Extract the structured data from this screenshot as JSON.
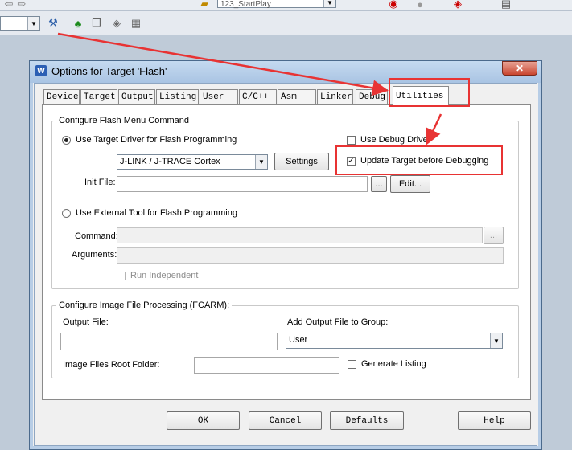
{
  "toolbar": {
    "target_combo_value": "",
    "project_combo_value": "123_StartPlay"
  },
  "dialog": {
    "title": "Options for Target 'Flash'",
    "close_glyph": "✕",
    "tabs": [
      "Device",
      "Target",
      "Output",
      "Listing",
      "User",
      "C/C++",
      "Asm",
      "Linker",
      "Debug",
      "Utilities"
    ],
    "active_tab": "Utilities"
  },
  "flash_group": {
    "title": "Configure Flash Menu Command",
    "use_target_driver_label": "Use Target Driver for Flash Programming",
    "use_debug_driver_label": "Use Debug Driver",
    "driver_value": "J-LINK / J-TRACE Cortex",
    "settings_label": "Settings",
    "update_target_label": "Update Target before Debugging",
    "init_file_label": "Init File:",
    "init_file_value": "",
    "browse_label": "...",
    "edit_label": "Edit...",
    "use_external_tool_label": "Use External Tool for Flash Programming",
    "command_label": "Command:",
    "command_value": "",
    "arguments_label": "Arguments:",
    "arguments_value": "",
    "run_independent_label": "Run Independent"
  },
  "image_group": {
    "title": "Configure Image File Processing (FCARM):",
    "output_file_label": "Output File:",
    "output_file_value": "",
    "add_output_label": "Add Output File  to Group:",
    "group_value": "User",
    "root_folder_label": "Image Files Root Folder:",
    "root_folder_value": "",
    "generate_listing_label": "Generate Listing"
  },
  "buttons": {
    "ok": "OK",
    "cancel": "Cancel",
    "defaults": "Defaults",
    "help": "Help"
  },
  "colors": {
    "annotation": "#e83333"
  }
}
